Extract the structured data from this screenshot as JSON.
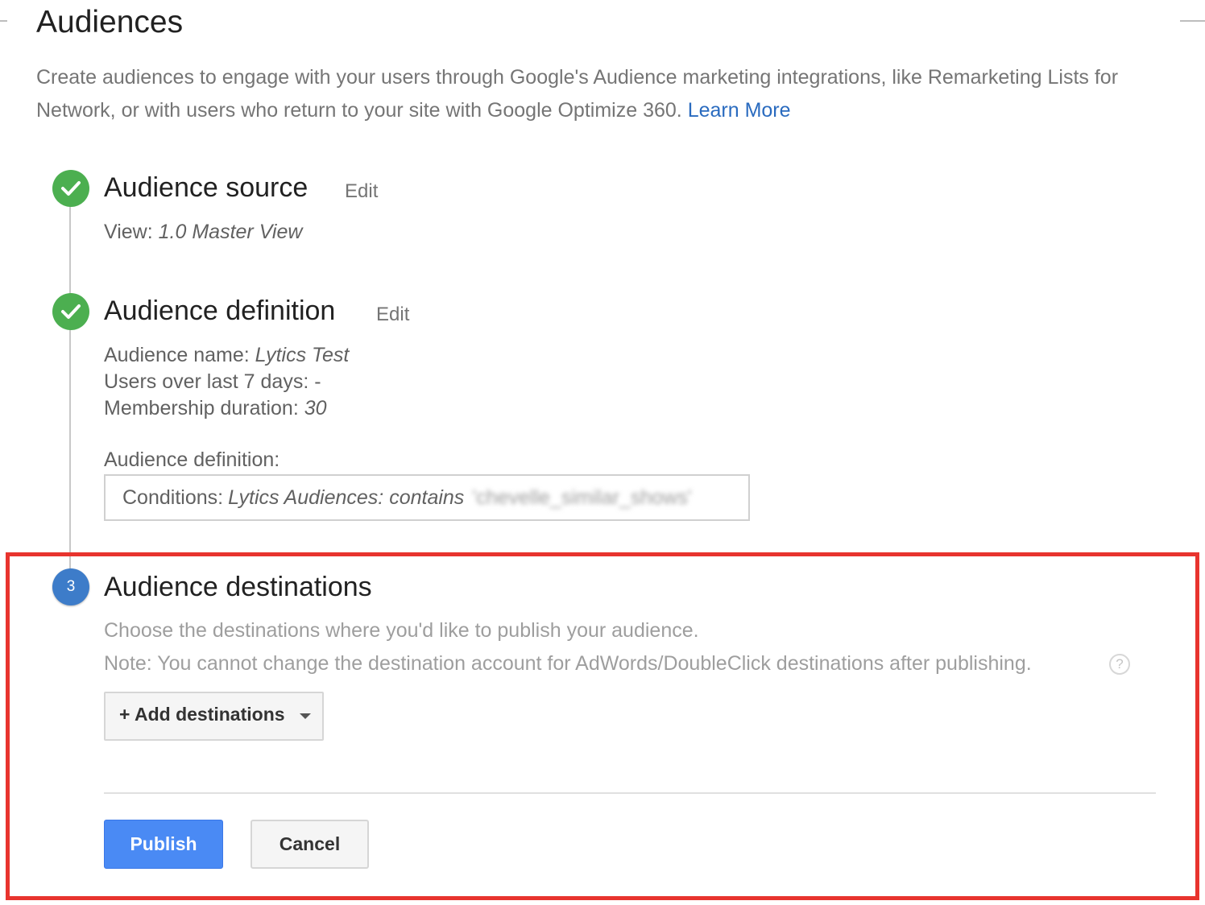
{
  "header": {
    "title": "Audiences",
    "description": "Create audiences to engage with your users through Google's Audience marketing integrations, like Remarketing Lists for",
    "description_line2": "Network, or with users who return to your site with Google Optimize 360.",
    "learn_more": "Learn More"
  },
  "steps": {
    "source": {
      "title": "Audience source",
      "edit": "Edit",
      "view_label": "View:",
      "view_value": "1.0 Master View"
    },
    "definition": {
      "title": "Audience definition",
      "edit": "Edit",
      "name_label": "Audience name:",
      "name_value": "Lytics Test",
      "users_label": "Users over last 7 days:",
      "users_value": "-",
      "duration_label": "Membership duration:",
      "duration_value": "30",
      "definition_label": "Audience definition:",
      "conditions_label": "Conditions:",
      "conditions_value": "Lytics Audiences: contains",
      "conditions_redacted": "'chevelle_similar_shows'"
    },
    "destinations": {
      "number": "3",
      "title": "Audience destinations",
      "desc1": "Choose the destinations where you'd like to publish your audience.",
      "desc2": "Note: You cannot change the destination account for AdWords/DoubleClick destinations after publishing.",
      "help": "?",
      "add_button": "+ Add destinations"
    }
  },
  "actions": {
    "publish": "Publish",
    "cancel": "Cancel"
  },
  "colors": {
    "accent": "#4a8af4",
    "link": "#2a6bbf",
    "complete": "#4caf50",
    "active_step": "#3d7cc9",
    "highlight": "#e8342e"
  },
  "icons": {
    "complete": "check-circle-icon",
    "help": "help-circle-icon",
    "dropdown": "caret-down-icon"
  }
}
